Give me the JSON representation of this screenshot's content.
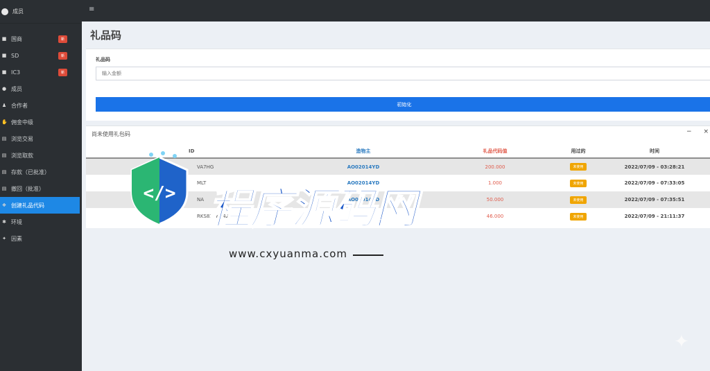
{
  "brand": {
    "name": "成员"
  },
  "topbar": {
    "menu_icon": "hamburger-icon"
  },
  "sidebar": {
    "items": [
      {
        "icon": "tag-icon",
        "label": "国商",
        "badge": "新"
      },
      {
        "icon": "tag-icon",
        "label": "SD",
        "badge": "新"
      },
      {
        "icon": "tag-icon",
        "label": "IC3",
        "badge": "新"
      },
      {
        "icon": "user-icon",
        "label": "成员",
        "badge": ""
      },
      {
        "icon": "group-icon",
        "label": "合作者",
        "badge": ""
      },
      {
        "icon": "hand-icon",
        "label": "佣金中级",
        "badge": ""
      },
      {
        "icon": "list-icon",
        "label": "浏览交易",
        "badge": ""
      },
      {
        "icon": "list-icon",
        "label": "浏览取款",
        "badge": ""
      },
      {
        "icon": "list-icon",
        "label": "存款（已批准）",
        "badge": ""
      },
      {
        "icon": "list-icon",
        "label": "撤回（批准）",
        "badge": ""
      },
      {
        "icon": "gift-icon",
        "label": "创建礼品代码",
        "badge": "",
        "active": true
      },
      {
        "icon": "gear-icon",
        "label": "环境",
        "badge": ""
      },
      {
        "icon": "power-icon",
        "label": "因素",
        "badge": ""
      }
    ]
  },
  "page": {
    "title": "礼品码"
  },
  "form": {
    "label": "礼品码",
    "placeholder": "输入金额",
    "button": "初始化"
  },
  "table": {
    "title": "尚未使用礼包码",
    "tools": {
      "minimize": "−",
      "close": "×"
    },
    "columns": [
      "ID",
      "造物主",
      "礼品代码值",
      "用过的",
      "时间"
    ],
    "rows": [
      {
        "id": "VA7HG",
        "owner": "AO02014YD",
        "amount": "200.000",
        "used": "未使用",
        "time": "2022/07/09 - 03:28:21"
      },
      {
        "id": "MLT",
        "owner": "AO02014YD",
        "amount": "1.000",
        "used": "未使用",
        "time": "2022/07/09 - 07:33:05"
      },
      {
        "id": "NA",
        "owner": "AO02014YD",
        "amount": "50.000",
        "used": "未使用",
        "time": "2022/07/09 - 07:35:51"
      },
      {
        "id": "RKS8ZYKH4ZR2BYRZ",
        "owner": "",
        "amount": "46.000",
        "used": "未使用",
        "time": "2022/07/09 - 21:11:37"
      }
    ]
  },
  "watermark": {
    "text": "程序源码网",
    "url": "www.cxyuanma.com"
  }
}
